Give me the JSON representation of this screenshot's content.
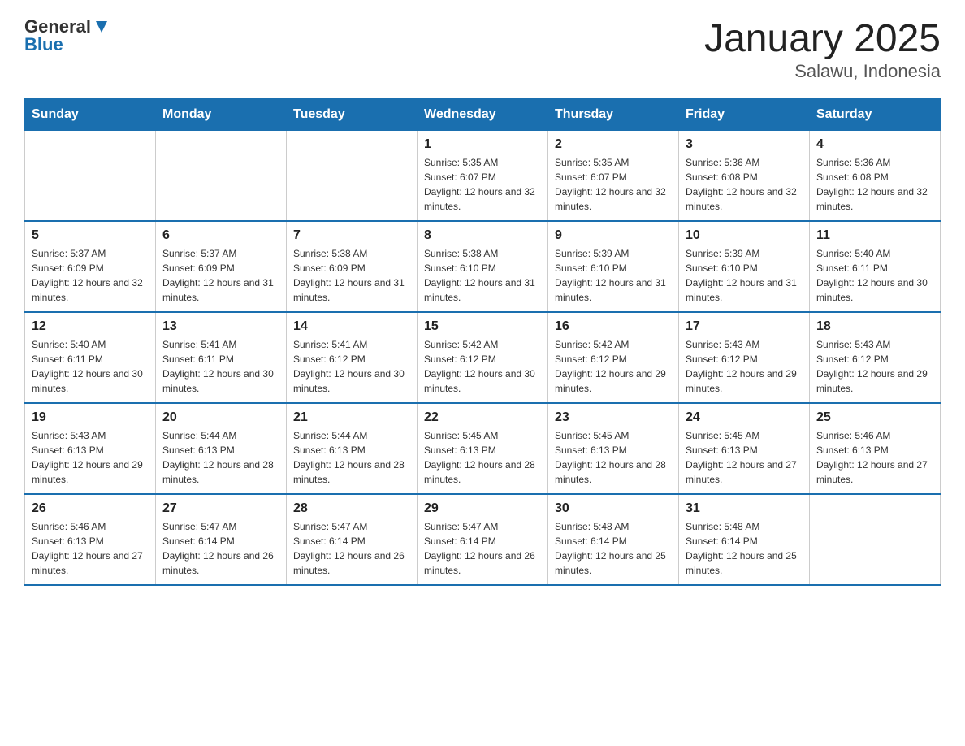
{
  "header": {
    "logo": {
      "general": "General",
      "blue": "Blue"
    },
    "title": "January 2025",
    "subtitle": "Salawu, Indonesia"
  },
  "days_of_week": [
    "Sunday",
    "Monday",
    "Tuesday",
    "Wednesday",
    "Thursday",
    "Friday",
    "Saturday"
  ],
  "weeks": [
    [
      {
        "day": "",
        "info": ""
      },
      {
        "day": "",
        "info": ""
      },
      {
        "day": "",
        "info": ""
      },
      {
        "day": "1",
        "info": "Sunrise: 5:35 AM\nSunset: 6:07 PM\nDaylight: 12 hours and 32 minutes."
      },
      {
        "day": "2",
        "info": "Sunrise: 5:35 AM\nSunset: 6:07 PM\nDaylight: 12 hours and 32 minutes."
      },
      {
        "day": "3",
        "info": "Sunrise: 5:36 AM\nSunset: 6:08 PM\nDaylight: 12 hours and 32 minutes."
      },
      {
        "day": "4",
        "info": "Sunrise: 5:36 AM\nSunset: 6:08 PM\nDaylight: 12 hours and 32 minutes."
      }
    ],
    [
      {
        "day": "5",
        "info": "Sunrise: 5:37 AM\nSunset: 6:09 PM\nDaylight: 12 hours and 32 minutes."
      },
      {
        "day": "6",
        "info": "Sunrise: 5:37 AM\nSunset: 6:09 PM\nDaylight: 12 hours and 31 minutes."
      },
      {
        "day": "7",
        "info": "Sunrise: 5:38 AM\nSunset: 6:09 PM\nDaylight: 12 hours and 31 minutes."
      },
      {
        "day": "8",
        "info": "Sunrise: 5:38 AM\nSunset: 6:10 PM\nDaylight: 12 hours and 31 minutes."
      },
      {
        "day": "9",
        "info": "Sunrise: 5:39 AM\nSunset: 6:10 PM\nDaylight: 12 hours and 31 minutes."
      },
      {
        "day": "10",
        "info": "Sunrise: 5:39 AM\nSunset: 6:10 PM\nDaylight: 12 hours and 31 minutes."
      },
      {
        "day": "11",
        "info": "Sunrise: 5:40 AM\nSunset: 6:11 PM\nDaylight: 12 hours and 30 minutes."
      }
    ],
    [
      {
        "day": "12",
        "info": "Sunrise: 5:40 AM\nSunset: 6:11 PM\nDaylight: 12 hours and 30 minutes."
      },
      {
        "day": "13",
        "info": "Sunrise: 5:41 AM\nSunset: 6:11 PM\nDaylight: 12 hours and 30 minutes."
      },
      {
        "day": "14",
        "info": "Sunrise: 5:41 AM\nSunset: 6:12 PM\nDaylight: 12 hours and 30 minutes."
      },
      {
        "day": "15",
        "info": "Sunrise: 5:42 AM\nSunset: 6:12 PM\nDaylight: 12 hours and 30 minutes."
      },
      {
        "day": "16",
        "info": "Sunrise: 5:42 AM\nSunset: 6:12 PM\nDaylight: 12 hours and 29 minutes."
      },
      {
        "day": "17",
        "info": "Sunrise: 5:43 AM\nSunset: 6:12 PM\nDaylight: 12 hours and 29 minutes."
      },
      {
        "day": "18",
        "info": "Sunrise: 5:43 AM\nSunset: 6:12 PM\nDaylight: 12 hours and 29 minutes."
      }
    ],
    [
      {
        "day": "19",
        "info": "Sunrise: 5:43 AM\nSunset: 6:13 PM\nDaylight: 12 hours and 29 minutes."
      },
      {
        "day": "20",
        "info": "Sunrise: 5:44 AM\nSunset: 6:13 PM\nDaylight: 12 hours and 28 minutes."
      },
      {
        "day": "21",
        "info": "Sunrise: 5:44 AM\nSunset: 6:13 PM\nDaylight: 12 hours and 28 minutes."
      },
      {
        "day": "22",
        "info": "Sunrise: 5:45 AM\nSunset: 6:13 PM\nDaylight: 12 hours and 28 minutes."
      },
      {
        "day": "23",
        "info": "Sunrise: 5:45 AM\nSunset: 6:13 PM\nDaylight: 12 hours and 28 minutes."
      },
      {
        "day": "24",
        "info": "Sunrise: 5:45 AM\nSunset: 6:13 PM\nDaylight: 12 hours and 27 minutes."
      },
      {
        "day": "25",
        "info": "Sunrise: 5:46 AM\nSunset: 6:13 PM\nDaylight: 12 hours and 27 minutes."
      }
    ],
    [
      {
        "day": "26",
        "info": "Sunrise: 5:46 AM\nSunset: 6:13 PM\nDaylight: 12 hours and 27 minutes."
      },
      {
        "day": "27",
        "info": "Sunrise: 5:47 AM\nSunset: 6:14 PM\nDaylight: 12 hours and 26 minutes."
      },
      {
        "day": "28",
        "info": "Sunrise: 5:47 AM\nSunset: 6:14 PM\nDaylight: 12 hours and 26 minutes."
      },
      {
        "day": "29",
        "info": "Sunrise: 5:47 AM\nSunset: 6:14 PM\nDaylight: 12 hours and 26 minutes."
      },
      {
        "day": "30",
        "info": "Sunrise: 5:48 AM\nSunset: 6:14 PM\nDaylight: 12 hours and 25 minutes."
      },
      {
        "day": "31",
        "info": "Sunrise: 5:48 AM\nSunset: 6:14 PM\nDaylight: 12 hours and 25 minutes."
      },
      {
        "day": "",
        "info": ""
      }
    ]
  ]
}
